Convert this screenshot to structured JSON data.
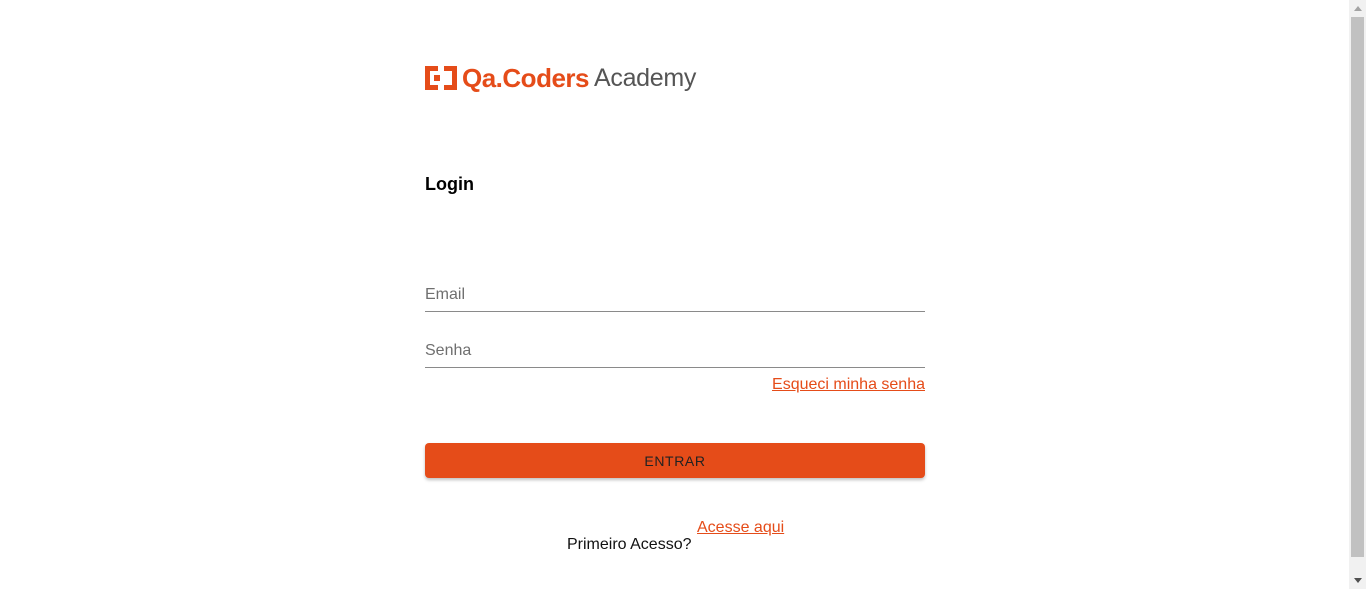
{
  "logo": {
    "brand": "Qa.Coders",
    "suffix": "Academy",
    "icon": "brackets-logo-icon",
    "brand_color": "#e54c19",
    "suffix_color": "#555555"
  },
  "login": {
    "title": "Login",
    "email_placeholder": "Email",
    "email_value": "",
    "password_placeholder": "Senha",
    "password_value": "",
    "forgot_label": "Esqueci minha senha",
    "submit_label": "ENTRAR",
    "first_access_text": "Primeiro Acesso?",
    "first_access_link": "Acesse aqui"
  },
  "colors": {
    "accent": "#e54c19",
    "background": "#ffffff"
  }
}
